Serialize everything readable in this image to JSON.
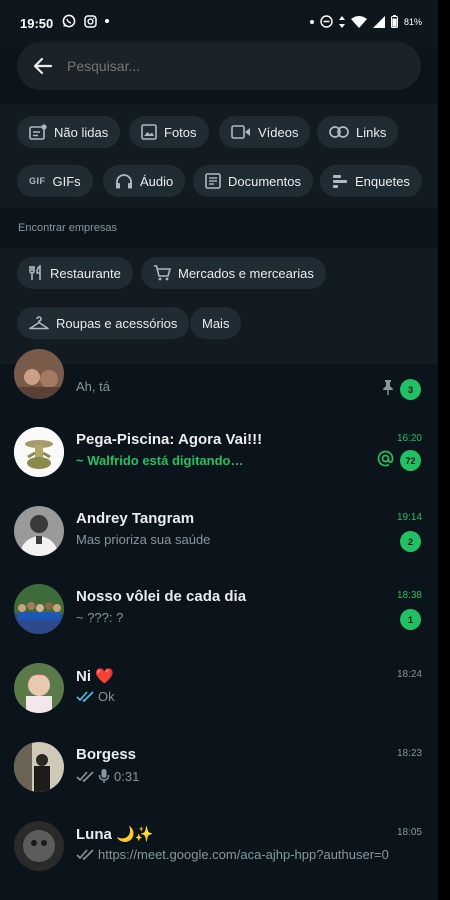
{
  "status_bar": {
    "time": "19:50",
    "battery": "81%"
  },
  "search": {
    "placeholder": "Pesquisar..."
  },
  "filters": [
    {
      "label": "Não lidas",
      "icon": "unread-icon"
    },
    {
      "label": "Fotos",
      "icon": "image-icon"
    },
    {
      "label": "Vídeos",
      "icon": "video-icon"
    },
    {
      "label": "Links",
      "icon": "link-icon"
    },
    {
      "label": "GIFs",
      "icon": "gif-icon",
      "icon_text": "GIF"
    },
    {
      "label": "Áudio",
      "icon": "headphones-icon"
    },
    {
      "label": "Documentos",
      "icon": "document-icon"
    },
    {
      "label": "Enquetes",
      "icon": "poll-icon"
    }
  ],
  "section": {
    "title": "Encontrar empresas"
  },
  "companies": [
    {
      "label": "Restaurante",
      "icon": "utensils-icon"
    },
    {
      "label": "Mercados e mercearias",
      "icon": "cart-icon"
    },
    {
      "label": "Roupas e acessórios",
      "icon": "hanger-icon"
    },
    {
      "label": "Mais"
    }
  ],
  "chats": [
    {
      "name": "",
      "preview": "Ah, tá",
      "time": "",
      "unread": "3",
      "pinned": true
    },
    {
      "name": "Pega-Piscina: Agora Vai!!!",
      "preview": "~ Walfrido está digitando…",
      "time": "16:20",
      "unread": "72",
      "mention": true
    },
    {
      "name": "Andrey Tangram",
      "preview": "Mas prioriza sua saúde",
      "time": "19:14",
      "unread": "2"
    },
    {
      "name": "Nosso vôlei de cada dia",
      "preview": "~ ???: ?",
      "time": "18:38",
      "unread": "1"
    },
    {
      "name": "Ni ❤️",
      "preview": "Ok",
      "time": "18:24",
      "read_ticks": "blue"
    },
    {
      "name": "Borgess",
      "preview": "0:31",
      "time": "18:23",
      "read_ticks": "grey",
      "voice": true
    },
    {
      "name": "Luna 🌙✨",
      "preview": "https://meet.google.com/aca-ajhp-hpp?authuser=0",
      "time": "18:05",
      "read_ticks": "grey"
    }
  ],
  "colors": {
    "accent": "#21c063",
    "background": "#0b141a",
    "chip": "#202c33",
    "blue_ticks": "#53bdeb"
  }
}
